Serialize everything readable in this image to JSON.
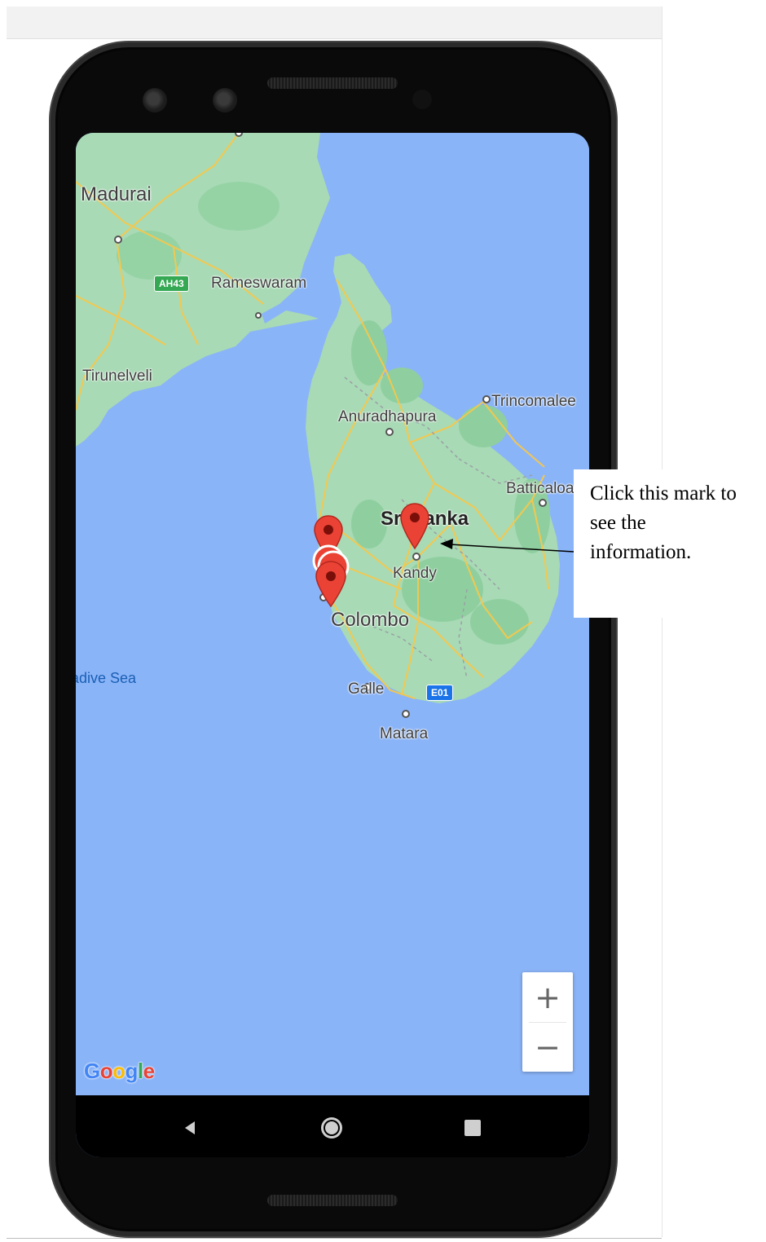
{
  "map": {
    "labels": {
      "madurai": "Madurai",
      "rameswaram": "Rameswaram",
      "tirunelveli": "Tirunelveli",
      "trincomalee": "Trincomalee",
      "anuradhapura": "Anuradhapura",
      "batticaloa": "Batticaloa",
      "sri_lanka": "Sri Lanka",
      "kandy": "Kandy",
      "colombo": "Colombo",
      "galle": "Galle",
      "matara": "Matara",
      "laccadive_sea": "Laccadive Sea"
    },
    "road_badges": {
      "ah43": "AH43",
      "e01": "E01"
    },
    "zoom": {
      "plus": "+",
      "minus": "−"
    },
    "attribution": {
      "letters": [
        "G",
        "o",
        "o",
        "g",
        "l",
        "e"
      ],
      "colors": [
        "#4285f4",
        "#ea4335",
        "#fbbc05",
        "#4285f4",
        "#34a853",
        "#ea4335"
      ]
    },
    "colors": {
      "water": "#8ab4f8",
      "land": "#a8dab5",
      "marker": "#ea4335"
    }
  },
  "annotation": {
    "line1": "Click this mark to",
    "line2": "see the",
    "line3": "information."
  },
  "navbar": {
    "icons": [
      "back-icon",
      "home-icon",
      "recents-icon"
    ]
  }
}
